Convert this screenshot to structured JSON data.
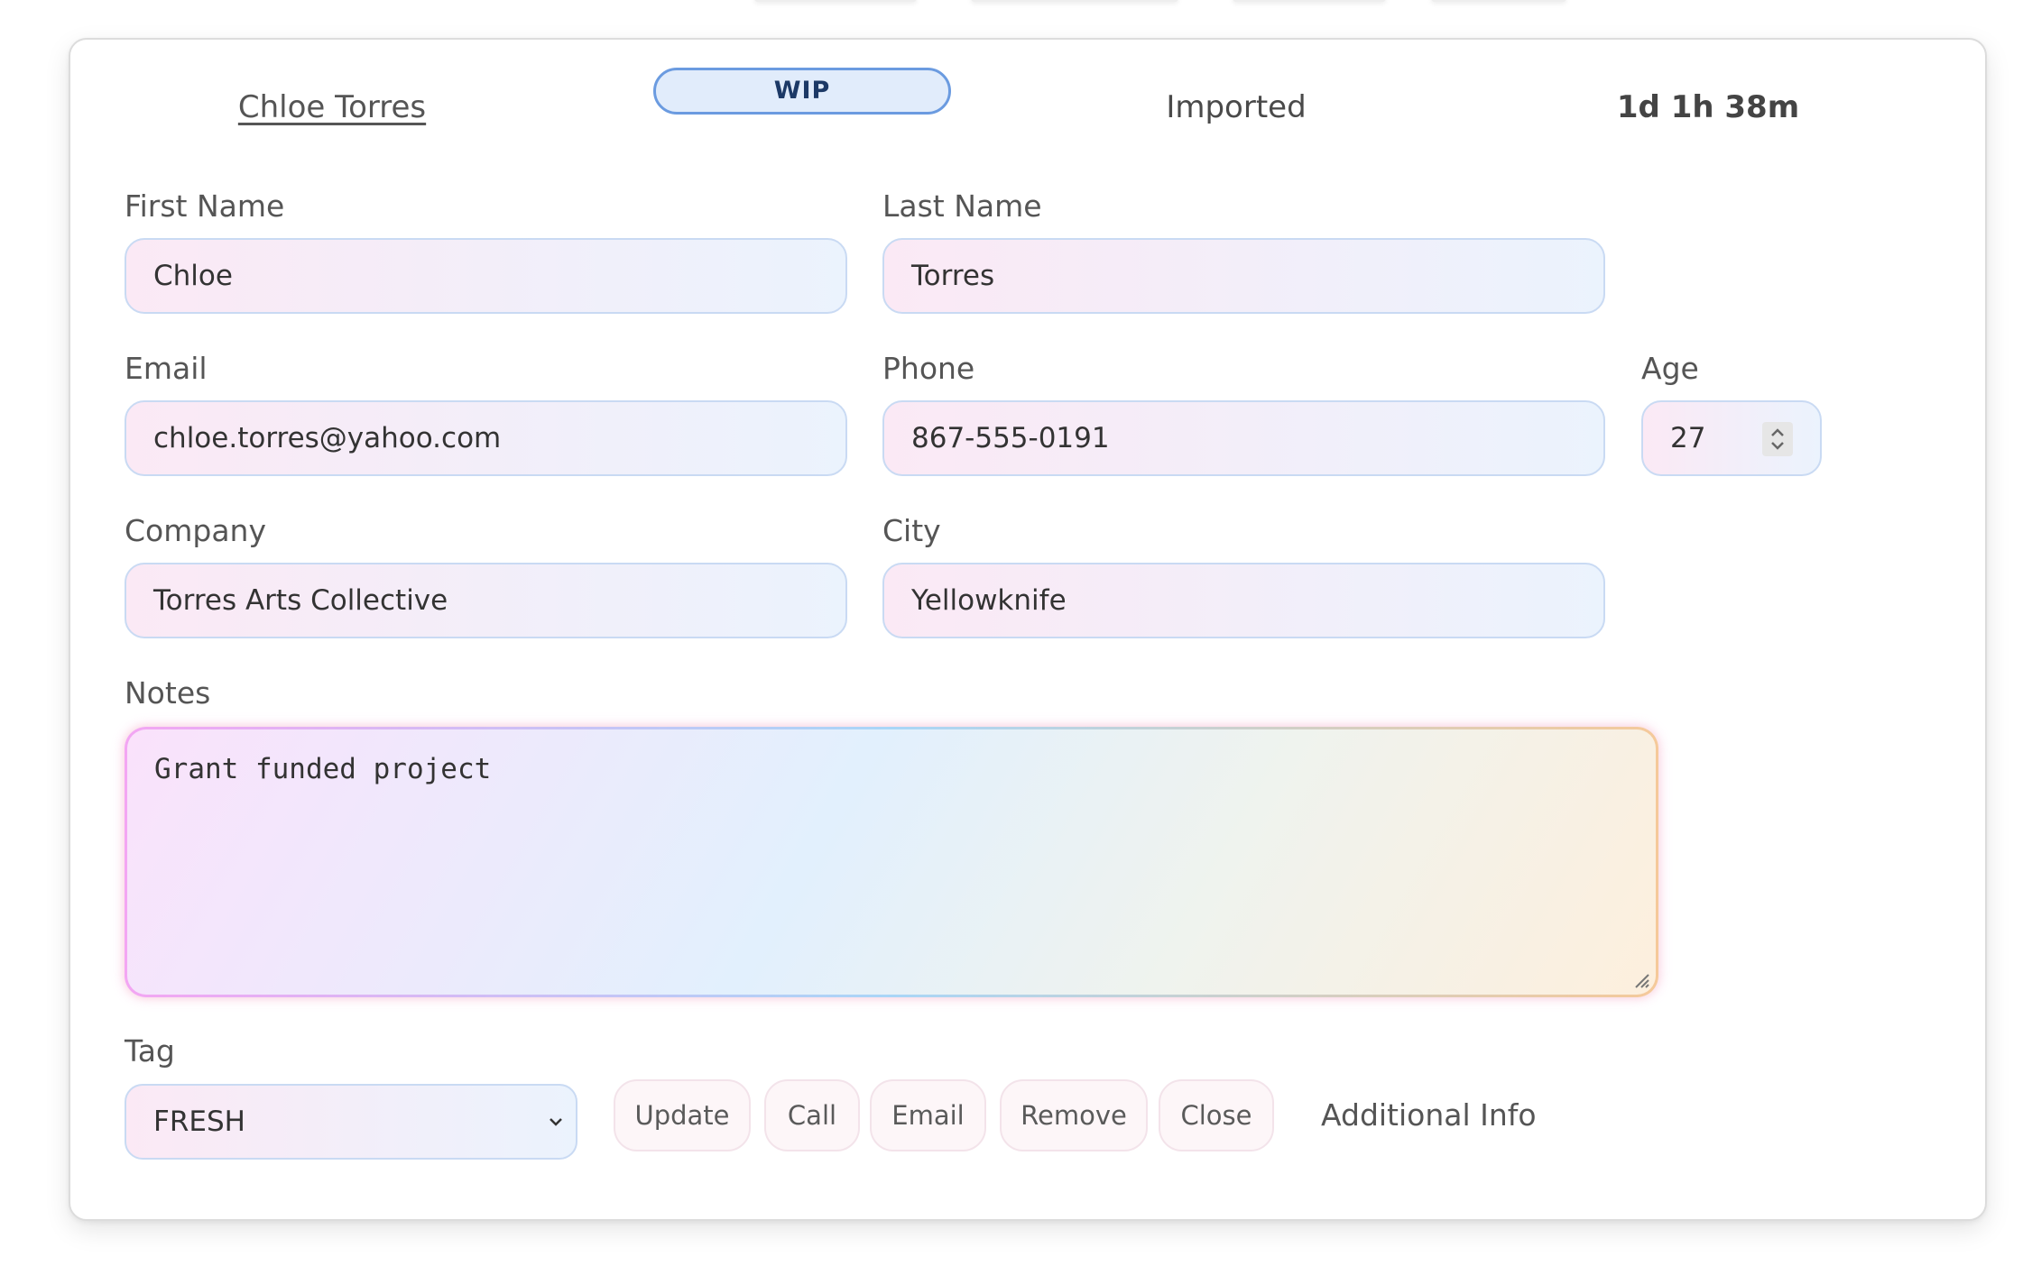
{
  "header": {
    "contact_name": "Chloe Torres",
    "status_badge": "WIP",
    "source": "Imported",
    "elapsed_time": "1d 1h 38m"
  },
  "form": {
    "first_name": {
      "label": "First Name",
      "value": "Chloe"
    },
    "last_name": {
      "label": "Last Name",
      "value": "Torres"
    },
    "email": {
      "label": "Email",
      "value": "chloe.torres@yahoo.com"
    },
    "phone": {
      "label": "Phone",
      "value": "867-555-0191"
    },
    "age": {
      "label": "Age",
      "value": "27"
    },
    "company": {
      "label": "Company",
      "value": "Torres Arts Collective"
    },
    "city": {
      "label": "City",
      "value": "Yellowknife"
    },
    "notes": {
      "label": "Notes",
      "value": "Grant funded project"
    },
    "tag": {
      "label": "Tag",
      "selected": "FRESH"
    }
  },
  "actions": {
    "update": "Update",
    "call": "Call",
    "email": "Email",
    "remove": "Remove",
    "close": "Close",
    "additional_info": "Additional Info"
  },
  "colors": {
    "badge_border": "#6b9be0",
    "badge_fill": "#e1ecfb",
    "input_border": "#c9daf3",
    "button_fill": "#fdf6f8"
  }
}
